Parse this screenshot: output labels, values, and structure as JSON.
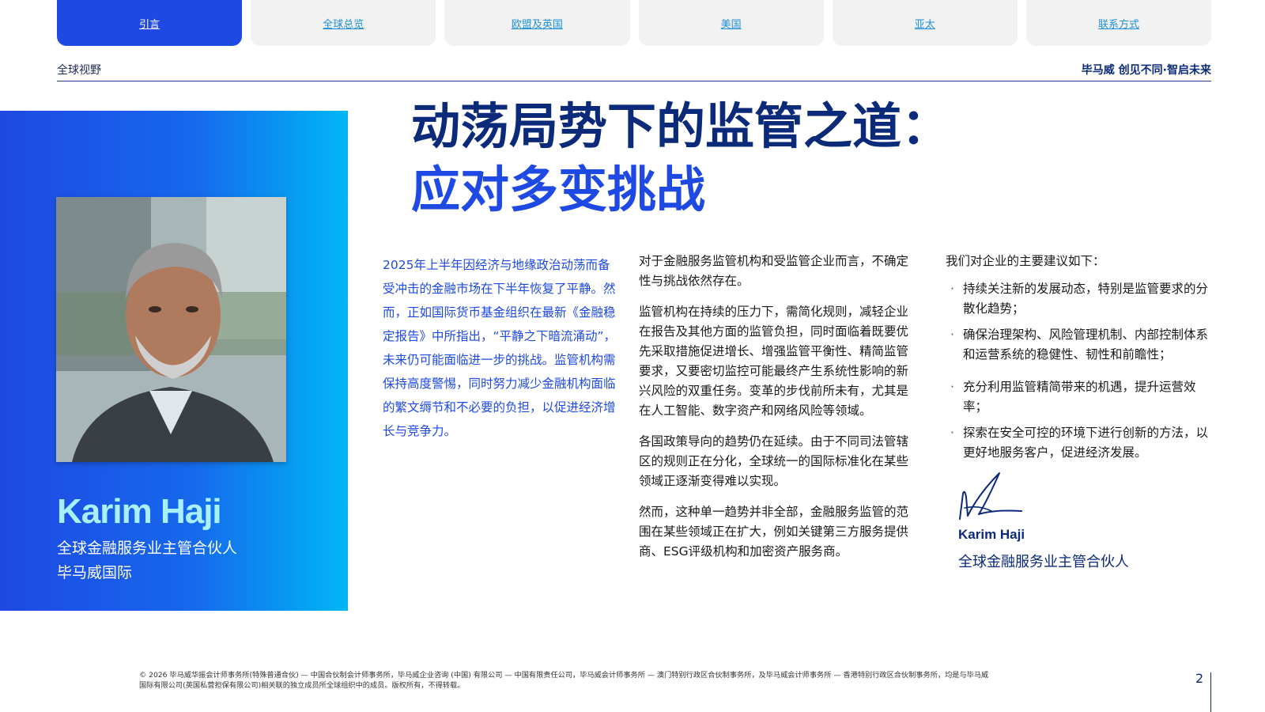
{
  "nav": {
    "tabs": [
      {
        "label": "引言",
        "active": true
      },
      {
        "label": "全球总览",
        "active": false
      },
      {
        "label": "欧盟及英国",
        "active": false
      },
      {
        "label": "美国",
        "active": false
      },
      {
        "label": "亚太",
        "active": false
      },
      {
        "label": "联系方式",
        "active": false
      }
    ]
  },
  "header": {
    "section": "全球视野",
    "brand_tagline": "毕马威 创见不同·智启未来"
  },
  "hero": {
    "name": "Karim Haji",
    "role_line1": "全球金融服务业主管合伙人",
    "role_line2": "毕马威国际"
  },
  "title": {
    "line1": "动荡局势下的监管之道：",
    "line2": "应对多变挑战"
  },
  "column1": {
    "text": "2025年上半年因经济与地缘政治动荡而备受冲击的金融市场在下半年恢复了平静。然而，正如国际货币基金组织在最新《金融稳定报告》中所指出，“平静之下暗流涌动”，未来仍可能面临进一步的挑战。监管机构需保持高度警惕，同时努力减少金融机构面临的繁文缛节和不必要的负担，以促进经济增长与竞争力。"
  },
  "column2": {
    "p1": "对于金融服务监管机构和受监管企业而言，不确定性与挑战依然存在。",
    "p2": "监管机构在持续的压力下，需简化规则，减轻企业在报告及其他方面的监管负担，同时面临着既要优先采取措施促进增长、增强监管平衡性、精简监管要求，又要密切监控可能最终产生系统性影响的新兴风险的双重任务。变革的步伐前所未有，尤其是在人工智能、数字资产和网络风险等领域。",
    "p3": "各国政策导向的趋势仍在延续。由于不同司法管辖区的规则正在分化，全球统一的国际标准化在某些领域正逐渐变得难以实现。",
    "p4": "然而，这种单一趋势并非全部，金融服务监管的范围在某些领域正在扩大，例如关键第三方服务提供商、ESG评级机构和加密资产服务商。"
  },
  "column3": {
    "intro": "我们对企业的主要建议如下：",
    "bullet_char": "·",
    "bullets": [
      "持续关注新的发展动态，特别是监管要求的分散化趋势；",
      "确保治理架构、风险管理机制、内部控制体系和运营系统的稳健性、韧性和前瞻性；",
      "充分利用监管精简带来的机遇，提升运营效率；",
      "探索在安全可控的环境下进行创新的方法，以更好地服务客户，促进经济发展。"
    ],
    "sign_name": "Karim Haji",
    "sign_role": "全球金融服务业主管合伙人"
  },
  "footer": {
    "legal": "© 2026 毕马威华振会计师事务所(特殊普通合伙) — 中国合伙制会计师事务所，毕马威企业咨询 (中国) 有限公司 — 中国有限责任公司，毕马威会计师事务所 — 澳门特别行政区合伙制事务所，及毕马威会计师事务所 — 香港特别行政区合伙制事务所，均是与毕马威国际有限公司(英国私营担保有限公司)相关联的独立成员所全球组织中的成员。版权所有，不得转载。",
    "page_number": "2"
  },
  "colors": {
    "brand_blue": "#1e49e2",
    "dark_blue": "#0c2a7a",
    "cyan": "#00b6f5",
    "light_cyan": "#a8f0ff"
  }
}
